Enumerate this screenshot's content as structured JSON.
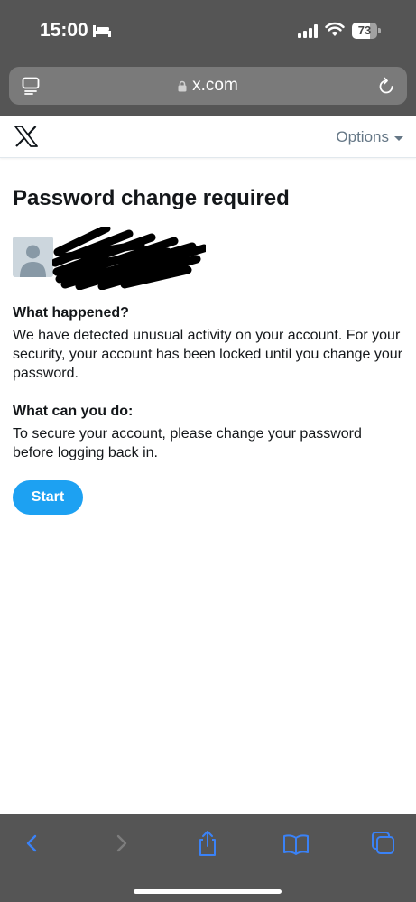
{
  "status_bar": {
    "time": "15:00",
    "battery": "73",
    "battery_fraction": 0.73
  },
  "browser": {
    "url": "x.com",
    "icons": [
      "tab-overview-icon",
      "lock-icon",
      "reload-icon"
    ]
  },
  "header": {
    "logo": "X",
    "options_label": "Options"
  },
  "main": {
    "title": "Password change required",
    "what_happened": {
      "heading": "What happened?",
      "text": "We have detected unusual activity on your account. For your security, your account has been locked until you change your password."
    },
    "what_can_you_do": {
      "heading": "What can you do:",
      "text": "To secure your account, please change your password before logging back in."
    },
    "start_label": "Start"
  },
  "toolbar": {
    "icons": [
      "back-icon",
      "forward-icon",
      "share-icon",
      "bookmarks-icon",
      "tabs-icon"
    ]
  },
  "colors": {
    "accent": "#1da1f2",
    "toolbar_icon": "#3a82f7",
    "chrome_bg": "#555555"
  }
}
